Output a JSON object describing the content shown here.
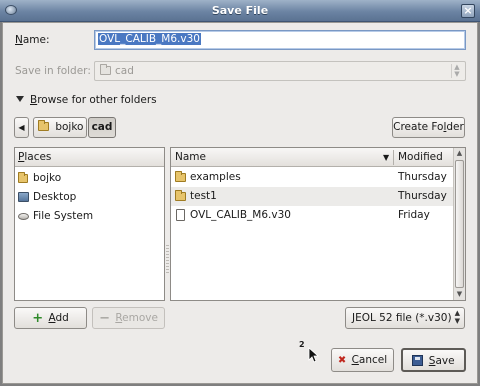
{
  "window": {
    "title": "Save File",
    "icon": "app-icon",
    "close_glyph": "×"
  },
  "name_field": {
    "label": "Name:",
    "label_mnemonic": "N",
    "label_rest": "ame:",
    "value": "OVL_CALIB_M6.v30"
  },
  "save_in": {
    "label": "Save in folder:",
    "value": "cad",
    "enabled": false
  },
  "browse": {
    "label": "Browse for other folders",
    "mnemonic": "B",
    "rest": "rowse for other folders",
    "expanded": true
  },
  "path_bar": {
    "back_glyph": "◀",
    "segments": [
      {
        "label": "bojko",
        "icon": "home-folder-icon"
      },
      {
        "label": "cad",
        "active": true
      }
    ]
  },
  "create_folder": {
    "label": "Create Folder",
    "pre": "Create Fo",
    "mnemonic": "l",
    "post": "der"
  },
  "places": {
    "header": "Places",
    "header_mnemonic": "P",
    "header_rest": "laces",
    "items": [
      {
        "label": "bojko",
        "icon": "home-folder-icon"
      },
      {
        "label": "Desktop",
        "icon": "desktop-icon"
      },
      {
        "label": "File System",
        "icon": "drive-icon"
      }
    ]
  },
  "files": {
    "columns": {
      "name": "Name",
      "modified": "Modified",
      "sort_glyph": "▼"
    },
    "rows": [
      {
        "name": "examples",
        "modified": "Thursday",
        "icon": "folder-icon"
      },
      {
        "name": "test1",
        "modified": "Thursday",
        "icon": "folder-icon",
        "highlight": true
      },
      {
        "name": "OVL_CALIB_M6.v30",
        "modified": "Friday",
        "icon": "file-icon"
      }
    ]
  },
  "add_button": {
    "label": "Add",
    "mnemonic": "A",
    "rest": "dd",
    "icon_glyph": "+"
  },
  "remove_button": {
    "label": "Remove",
    "mnemonic": "R",
    "rest": "emove",
    "icon_glyph": "−",
    "enabled": false
  },
  "filter": {
    "value": "JEOL 52 file (*.v30)"
  },
  "cancel_button": {
    "label": "Cancel",
    "mnemonic": "C",
    "rest": "ancel",
    "icon_glyph": "✖"
  },
  "save_button": {
    "label": "Save",
    "mnemonic": "S",
    "rest": "ave"
  },
  "cursor": {
    "badge": "2"
  },
  "colors": {
    "title_bar": "#6c84a3",
    "selection": "#4a78c2",
    "dialog_bg": "#edebe9",
    "folder": "#e7c46b"
  }
}
